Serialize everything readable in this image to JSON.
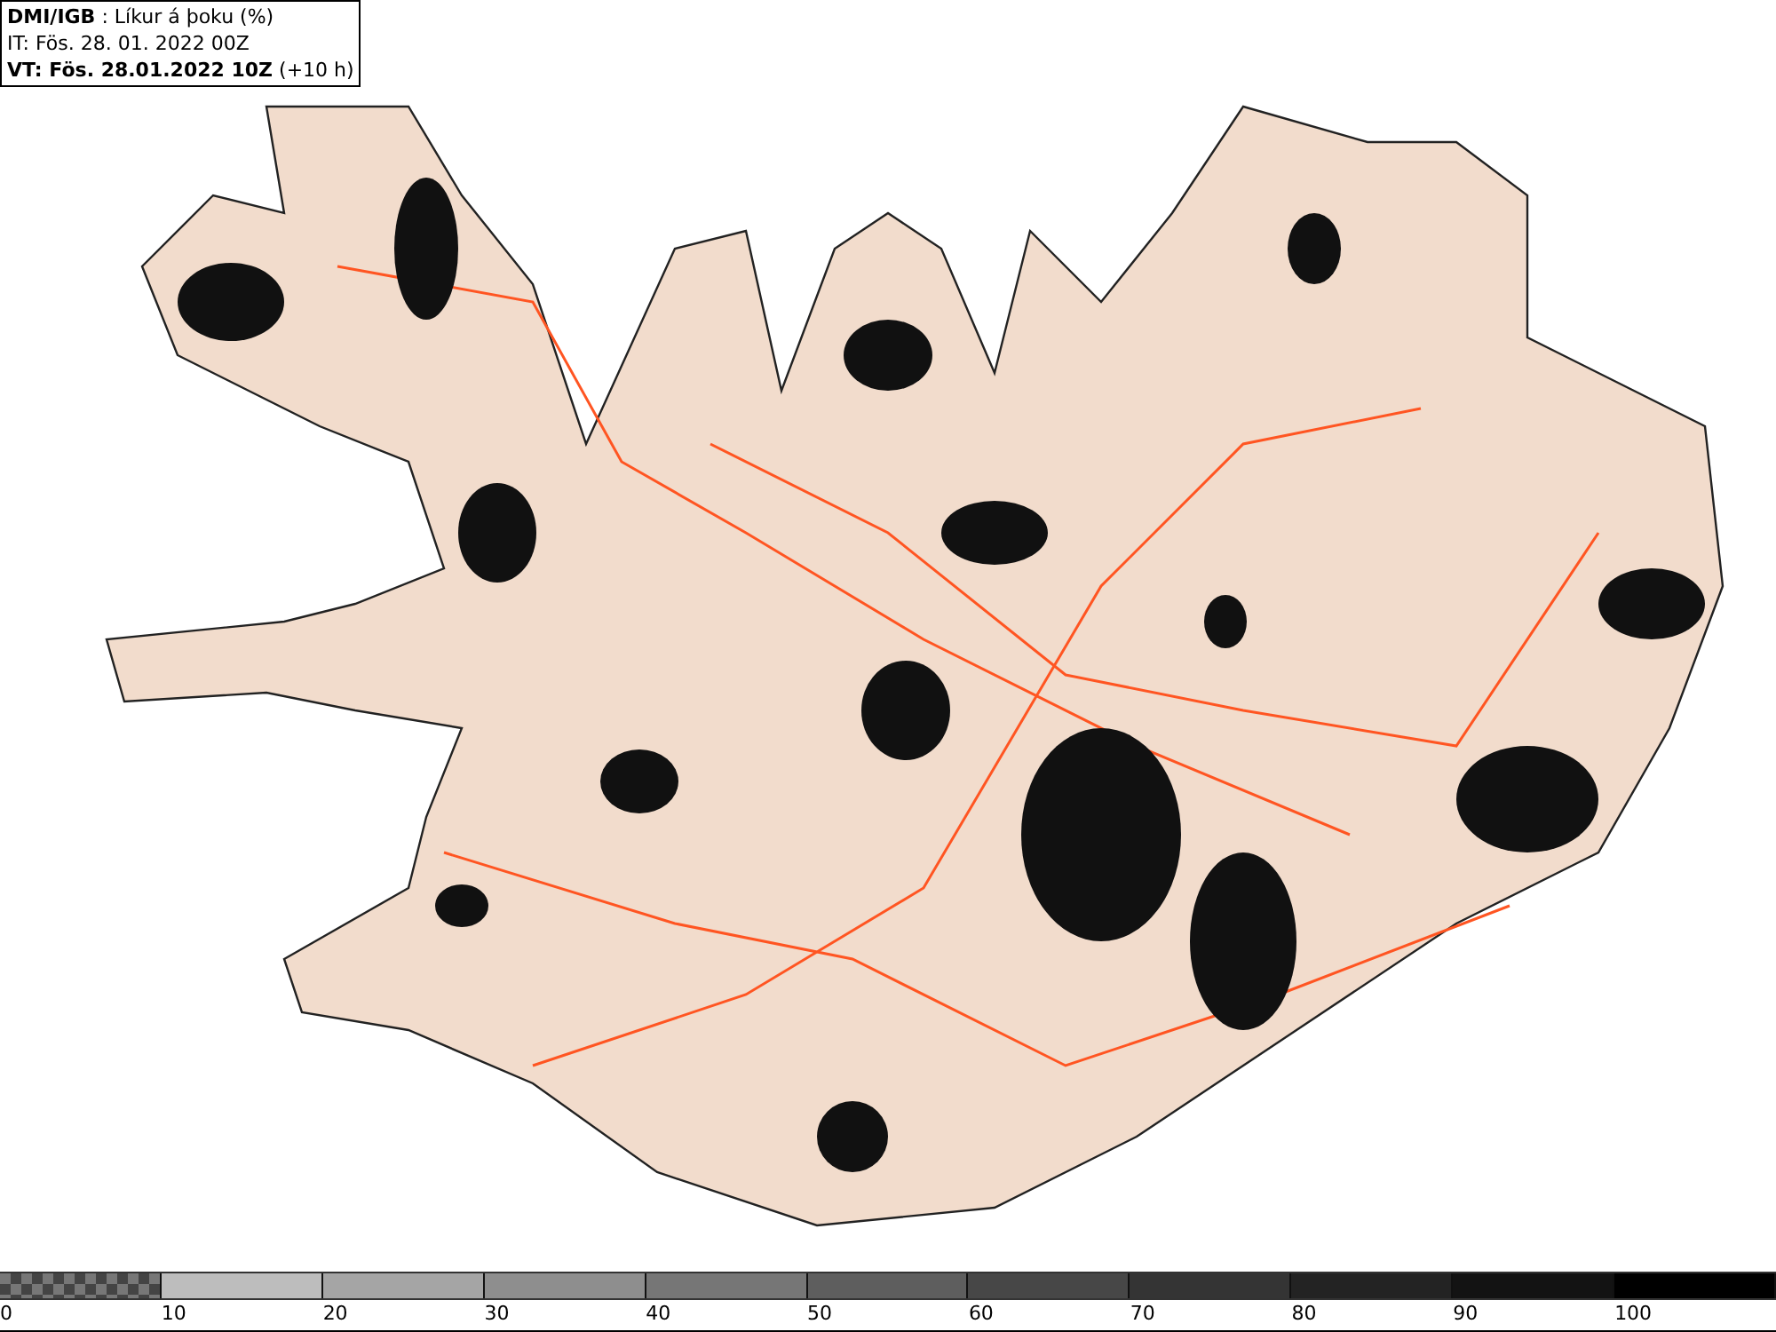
{
  "header": {
    "source": "DMI/IGB",
    "title": " : Líkur á þoku (%)",
    "issue_time": "IT: Fös. 28. 01. 2022 00Z",
    "valid_time": "VT: Fös. 28.01.2022 10Z",
    "lead_time": " (+10 h)"
  },
  "legend": {
    "segments": [
      {
        "kind": "checker",
        "color": "#777777"
      },
      {
        "kind": "solid",
        "color": "#bdbdbd"
      },
      {
        "kind": "solid",
        "color": "#a5a5a5"
      },
      {
        "kind": "solid",
        "color": "#8e8e8e"
      },
      {
        "kind": "solid",
        "color": "#767676"
      },
      {
        "kind": "solid",
        "color": "#5e5e5e"
      },
      {
        "kind": "solid",
        "color": "#474747"
      },
      {
        "kind": "solid",
        "color": "#343434"
      },
      {
        "kind": "solid",
        "color": "#232323"
      },
      {
        "kind": "solid",
        "color": "#131313"
      },
      {
        "kind": "solid",
        "color": "#000000"
      }
    ],
    "labels": [
      "0",
      "10",
      "20",
      "30",
      "40",
      "50",
      "60",
      "70",
      "80",
      "90",
      "100"
    ]
  }
}
